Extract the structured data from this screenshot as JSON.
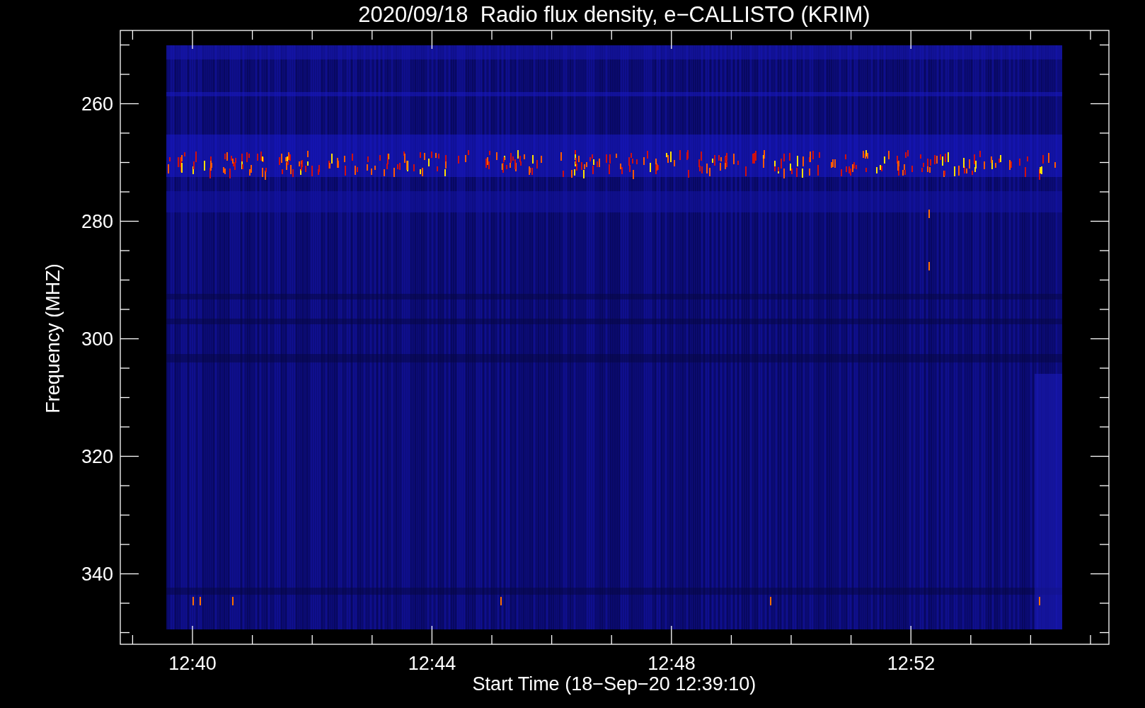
{
  "title": "2020/09/18  Radio flux density, e−CALLISTO (KRIM)",
  "y_axis": {
    "label": "Frequency (MHZ)",
    "ticks": [
      "260",
      "280",
      "300",
      "320",
      "340"
    ]
  },
  "x_axis": {
    "label": "Start Time (18−Sep−20 12:39:10)",
    "ticks": [
      "12:40",
      "12:44",
      "12:48",
      "12:52"
    ]
  }
}
